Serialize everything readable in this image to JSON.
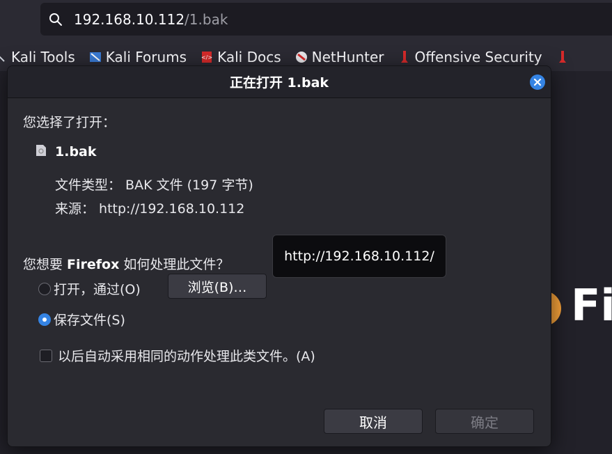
{
  "urlbar": {
    "host": "192.168.10.112",
    "path": "/1.bak",
    "icon": "search-icon"
  },
  "bookmarks": [
    {
      "label": "Kali Tools",
      "icon": "kali-icon"
    },
    {
      "label": "Kali Forums",
      "icon": "kali-forums-icon"
    },
    {
      "label": "Kali Docs",
      "icon": "kali-docs-icon"
    },
    {
      "label": "NetHunter",
      "icon": "nethunter-icon"
    },
    {
      "label": "Offensive Security",
      "icon": "offsec-icon"
    }
  ],
  "page": {
    "brand_fragment": "Fi"
  },
  "dialog": {
    "title": "正在打开 1.bak",
    "prompt": "您选择了打开：",
    "file_name": "1.bak",
    "file_type": "文件类型： BAK 文件 (197 字节)",
    "file_source": "来源： http://192.168.10.112",
    "question_prefix": "您想要 ",
    "question_app": "Firefox",
    "question_suffix": " 如何处理此文件？",
    "tooltip": "http://192.168.10.112/",
    "open_with_label": "打开，通过(O)",
    "open_with_checked": false,
    "browse_label": "浏览(B)…",
    "save_label": "保存文件(S)",
    "save_checked": true,
    "auto_label": "以后自动采用相同的动作处理此类文件。(A)",
    "auto_checked": false,
    "cancel_label": "取消",
    "ok_label": "确定"
  },
  "colors": {
    "accent": "#3584e4",
    "dialog_bg": "#2a2a30",
    "chrome_bg": "#2b2a33"
  }
}
